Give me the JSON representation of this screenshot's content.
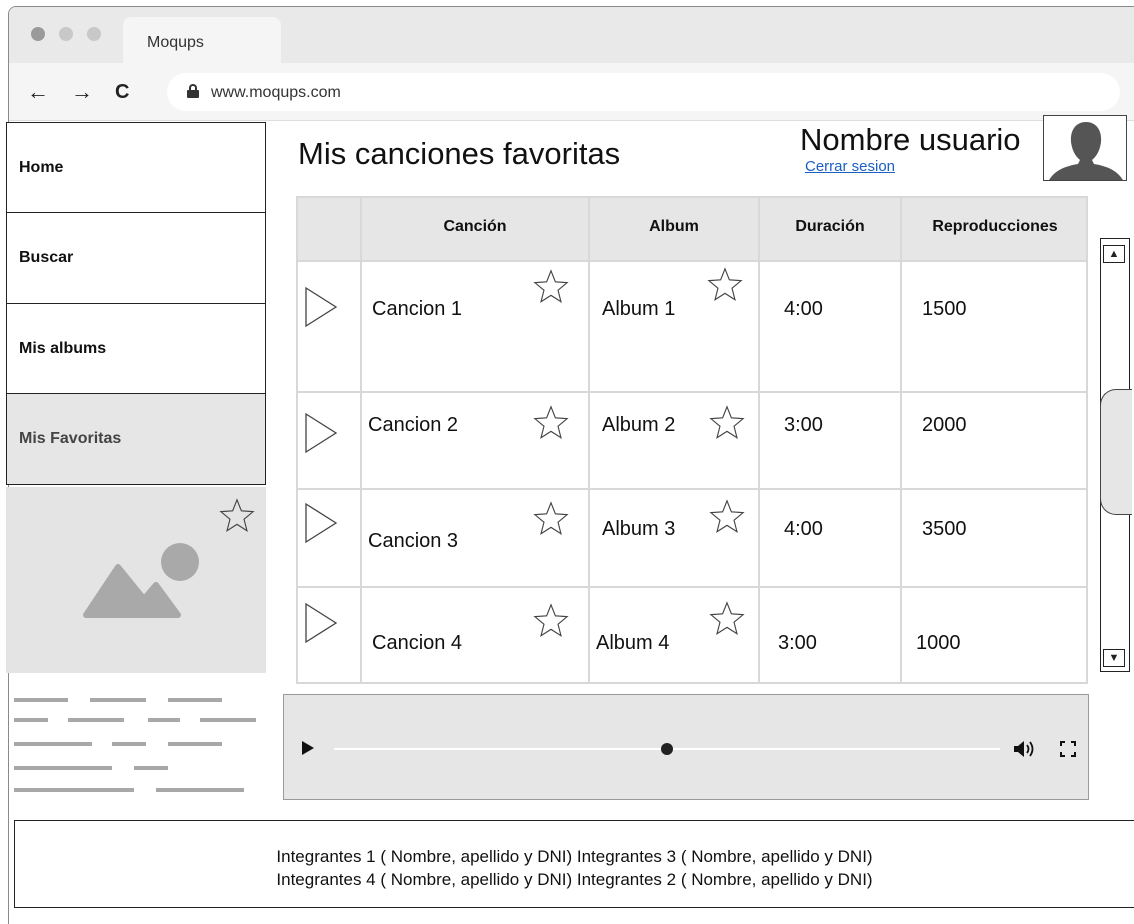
{
  "browser": {
    "tab_title": "Moqups",
    "url": "www.moqups.com"
  },
  "sidebar": {
    "items": [
      {
        "label": "Home"
      },
      {
        "label": "Buscar"
      },
      {
        "label": "Mis albums"
      },
      {
        "label": "Mis Favoritas"
      }
    ]
  },
  "header": {
    "title": "Mis canciones favoritas",
    "user_name": "Nombre usuario",
    "logout": "Cerrar sesion"
  },
  "table": {
    "headers": [
      "Canción",
      "Album",
      "Duración",
      "Reproducciones"
    ],
    "rows": [
      {
        "song": "Cancion 1",
        "album": "Album 1",
        "duration": "4:00",
        "plays": "1500"
      },
      {
        "song": "Cancion 2",
        "album": "Album 2",
        "duration": "3:00",
        "plays": "2000"
      },
      {
        "song": "Cancion 3",
        "album": "Album 3",
        "duration": "4:00",
        "plays": "3500"
      },
      {
        "song": "Cancion 4",
        "album": "Album 4",
        "duration": "3:00",
        "plays": "1000"
      }
    ]
  },
  "player": {
    "progress_fraction": 0.5
  },
  "footer": {
    "line1": "Integrantes 1 ( Nombre, apellido y DNI) Integrantes 3 ( Nombre, apellido y DNI)",
    "line2": "Integrantes 4 ( Nombre, apellido y DNI) Integrantes 2 ( Nombre, apellido y DNI)"
  },
  "icons": {
    "play": "play-outline-icon",
    "star": "star-outline-icon",
    "avatar": "user-silhouette-icon",
    "image": "image-placeholder-icon"
  },
  "colors": {
    "link": "#1a5fc2",
    "panel": "#e6e6e6",
    "active_nav": "#e6e6e6"
  }
}
